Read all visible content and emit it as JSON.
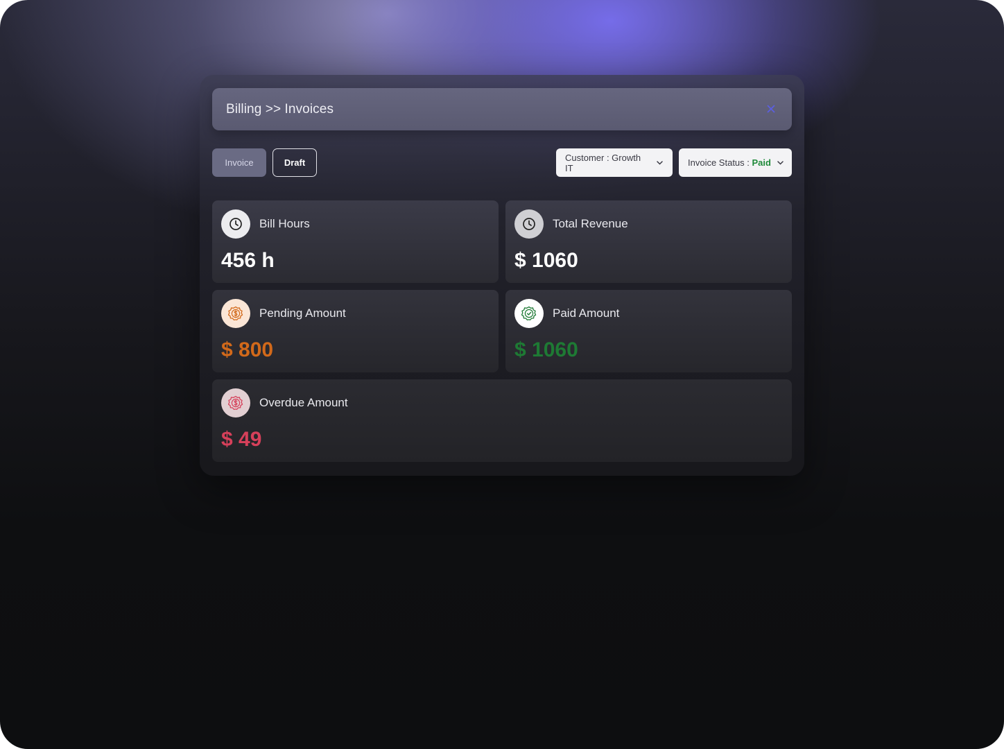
{
  "header": {
    "breadcrumb": "Billing >> Invoices",
    "close_icon": "close-icon"
  },
  "tabs": {
    "invoice_label": "Invoice",
    "draft_label": "Draft",
    "active": "Invoice"
  },
  "filters": {
    "customer_label": "Customer : Growth IT",
    "status_prefix": "Invoice Status : ",
    "status_value": "Paid"
  },
  "cards": {
    "bill_hours": {
      "label": "Bill Hours",
      "value": "456 h",
      "icon": "clock-icon"
    },
    "total_revenue": {
      "label": "Total Revenue",
      "value": "$ 1060",
      "icon": "clock-icon"
    },
    "pending_amount": {
      "label": "Pending Amount",
      "value": "$ 800",
      "icon": "dollar-badge-icon",
      "color": "#d2691a"
    },
    "paid_amount": {
      "label": "Paid Amount",
      "value": "$ 1060",
      "icon": "check-badge-icon",
      "color": "#1e7a34"
    },
    "overdue_amount": {
      "label": "Overdue Amount",
      "value": "$ 49",
      "icon": "dollar-badge-icon",
      "color": "#d6405a"
    }
  },
  "colors": {
    "accent": "#5b5fe0",
    "paid_green": "#1f8a3a",
    "pending_orange": "#d2691a",
    "overdue_red": "#d6405a"
  }
}
